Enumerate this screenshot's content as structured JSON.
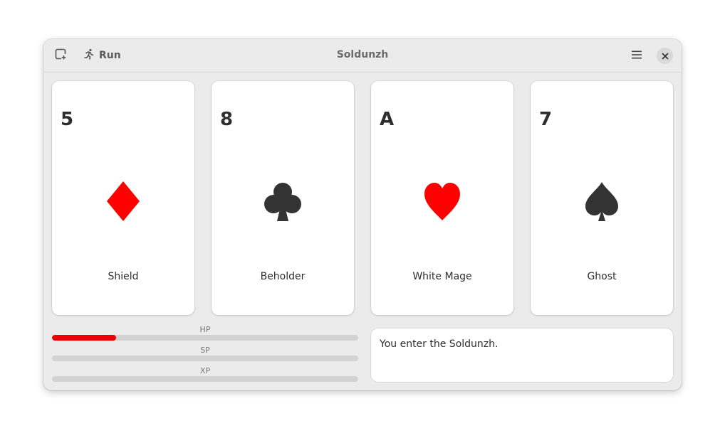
{
  "window": {
    "title": "Soldunzh"
  },
  "toolbar": {
    "run_label": "Run"
  },
  "icons": {
    "new_game": "new-game-icon",
    "run": "running-figure-icon",
    "menu": "hamburger-menu-icon",
    "close": "close-icon"
  },
  "cards": [
    {
      "rank": "5",
      "suit": "diamonds",
      "color": "#ff0000",
      "name": "Shield"
    },
    {
      "rank": "8",
      "suit": "clubs",
      "color": "#333333",
      "name": "Beholder"
    },
    {
      "rank": "A",
      "suit": "hearts",
      "color": "#ff0000",
      "name": "White Mage"
    },
    {
      "rank": "7",
      "suit": "spades",
      "color": "#333333",
      "name": "Ghost"
    }
  ],
  "stats": [
    {
      "label": "HP",
      "fraction": 0.21,
      "color": "#ee0000"
    },
    {
      "label": "SP",
      "fraction": 0,
      "color": "#ee0000"
    },
    {
      "label": "XP",
      "fraction": 0,
      "color": "#ee0000"
    }
  ],
  "log": {
    "message": "You enter the Soldunzh."
  }
}
